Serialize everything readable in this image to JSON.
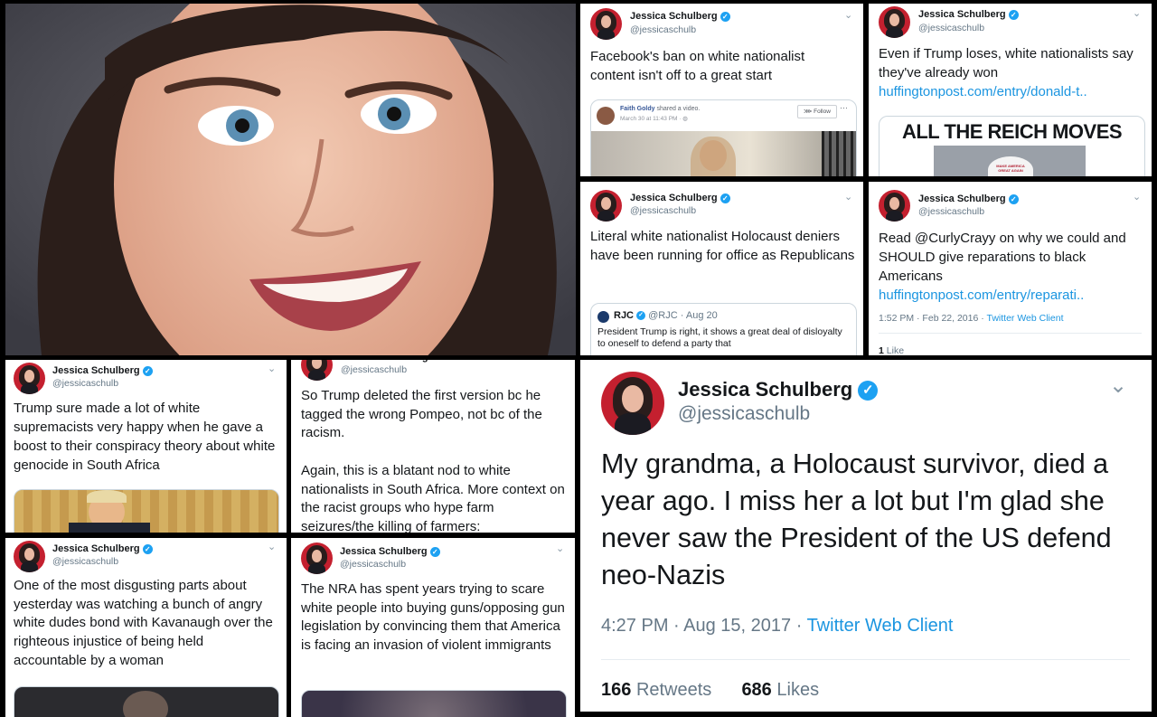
{
  "author": {
    "name": "Jessica Schulberg",
    "handle": "@jessicaschulb"
  },
  "tweets": {
    "t1": {
      "text": "Facebook's ban on white nationalist content isn't off to a great start",
      "embed": {
        "poster": "Faith Goldy",
        "action": "shared a video.",
        "date": "March 30 at 11:43 PM · ",
        "follow": "Follow",
        "more": "···"
      }
    },
    "t2": {
      "text": "Even if Trump loses, white nationalists say they've already won",
      "link": "huffingtonpost.com/entry/donald-t..",
      "card_headline": "ALL THE REICH MOVES",
      "hat_text": "MAKE AMERICA GREAT AGAIN"
    },
    "t3": {
      "text": "Literal white nationalist Holocaust deniers have been running for office as Republicans",
      "quote": {
        "name": "RJC",
        "handle": "@RJC",
        "date": "· Aug 20",
        "text": "President Trump is right, it shows a great deal of disloyalty to oneself to defend a party that"
      }
    },
    "t4": {
      "text": "Read @CurlyCrayy on why we could and SHOULD give reparations to black Americans",
      "link": "huffingtonpost.com/entry/reparati..",
      "time": "1:52 PM · Feb 22, 2016",
      "client": "Twitter Web Client",
      "likes_count": "1",
      "likes_label": "Like"
    },
    "t5": {
      "text": "Trump sure made a lot of white supremacists very happy when he gave a boost to their conspiracy theory about white genocide in South Africa"
    },
    "t6": {
      "text": "So Trump deleted the first version bc he tagged the wrong Pompeo, not bc of the racism.\n\nAgain, this is a blatant nod to white nationalists in South Africa. More context on the racist groups who hype farm seizures/the killing of farmers:"
    },
    "t7": {
      "text": "One of the most disgusting parts about yesterday was watching a bunch of angry white dudes bond with Kavanaugh over the righteous injustice of being held accountable by a woman"
    },
    "t8": {
      "text": "The NRA has spent years trying to scare white people into buying guns/opposing gun legislation by convincing them that America is facing an invasion of violent immigrants"
    },
    "main": {
      "text": "My grandma, a Holocaust survivor, died a year ago. I miss her a lot but I'm glad she never saw the President of the US defend neo-Nazis",
      "time": "4:27 PM · Aug 15, 2017 · ",
      "client": "Twitter Web Client",
      "retweets_count": "166",
      "retweets_label": "Retweets",
      "likes_count": "686",
      "likes_label": "Likes"
    }
  },
  "icons": {
    "verified": "checkmark-badge-icon",
    "chevron": "chevron-down-icon",
    "globe": "globe-icon"
  },
  "colors": {
    "brand": "#1da1f2",
    "link": "#1b95e0",
    "text": "#14171a",
    "muted": "#657786",
    "avatar_bg": "#c4202f"
  }
}
